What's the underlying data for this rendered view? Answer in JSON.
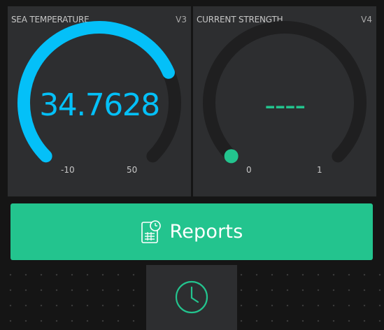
{
  "gauges": [
    {
      "title": "SEA TEMPERATURE",
      "pin": "V3",
      "value": "34.7628",
      "min": "-10",
      "max": "50",
      "fraction": 0.746,
      "color": "#04c0f8"
    },
    {
      "title": "CURRENT STRENGTH",
      "pin": "V4",
      "value": "----",
      "min": "0",
      "max": "1",
      "fraction": 0,
      "color": "#23c48e"
    }
  ],
  "reports": {
    "label": "Reports",
    "icon": "report-document-clock-icon",
    "color": "#23c48e"
  },
  "timer": {
    "icon": "clock-icon",
    "color": "#23c48e"
  },
  "colors": {
    "background": "#151515",
    "widget": "#2d2e30",
    "track": "#1f1f20"
  }
}
